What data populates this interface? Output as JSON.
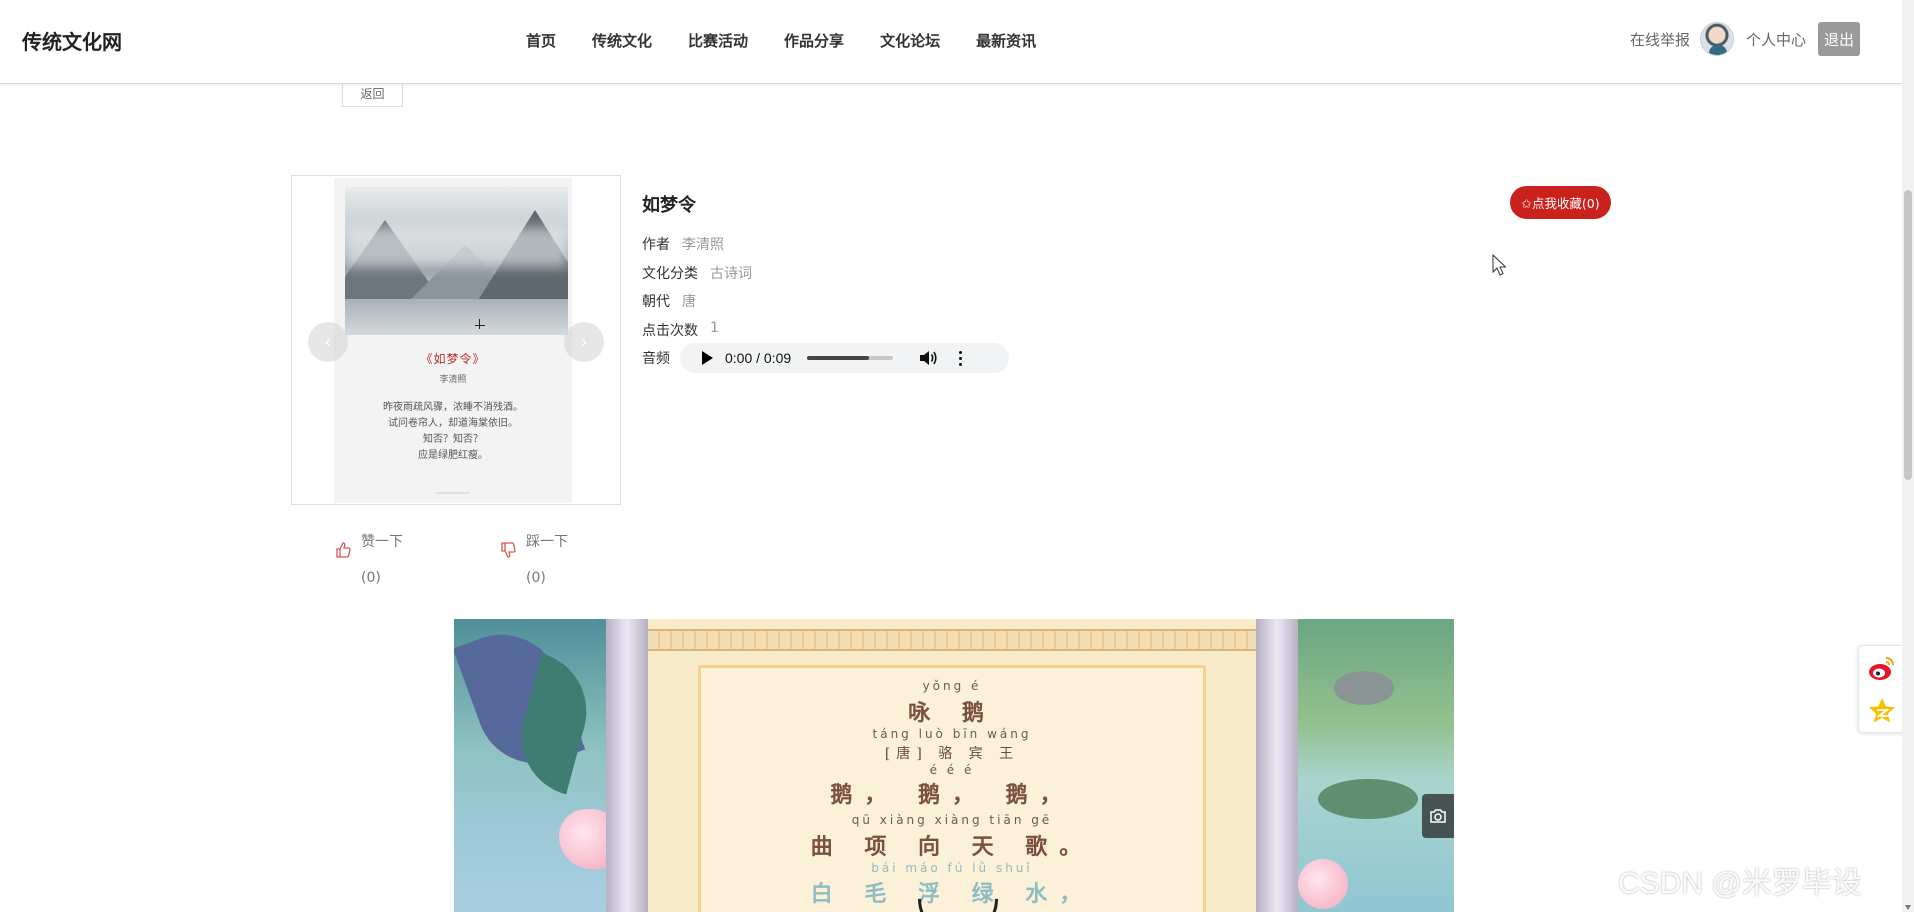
{
  "header": {
    "brand": "传统文化网",
    "nav": [
      "首页",
      "传统文化",
      "比赛活动",
      "作品分享",
      "文化论坛",
      "最新资讯"
    ],
    "report": "在线举报",
    "user_center": "个人中心",
    "logout": "退出"
  },
  "back_label": "返回",
  "carousel": {
    "poem_title": "《如梦令》",
    "poem_author": "李清照",
    "poem_lines": [
      "昨夜雨疏风骤，浓睡不消残酒。",
      "试问卷帘人，却道海棠依旧。",
      "知否？知否？",
      "应是绿肥红瘦。"
    ]
  },
  "votes": {
    "like_label": "赞一下",
    "like_count": "(0)",
    "dislike_label": "踩一下",
    "dislike_count": "(0)"
  },
  "detail": {
    "title": "如梦令",
    "rows": [
      {
        "key": "作者",
        "value": "李清照"
      },
      {
        "key": "文化分类",
        "value": "古诗词"
      },
      {
        "key": "朝代",
        "value": "唐"
      },
      {
        "key": "点击次数",
        "value": "1"
      }
    ],
    "audio_label": "音频",
    "audio_time": "0:00 / 0:09",
    "audio_volume_fraction": 0.72
  },
  "favorite_button": "✩点我收藏(0)",
  "video": {
    "line1_py": "yǒng é",
    "line1": "咏 鹅",
    "line2_py": "táng luò bīn wáng",
    "line2": "[唐] 骆 宾 王",
    "line3_py": "é é é",
    "line3": "鹅， 鹅， 鹅，",
    "line4_py": "qū xiàng xiàng tiān gē",
    "line4": "曲 项 向 天 歌。",
    "line5_py": "bái máo fú lǜ shuǐ",
    "line5": "白 毛 浮 绿 水，"
  },
  "watermark": "CSDN @米罗毕设",
  "colors": {
    "accent_red": "#c9221c",
    "logout_gray": "#9a9a9a"
  }
}
